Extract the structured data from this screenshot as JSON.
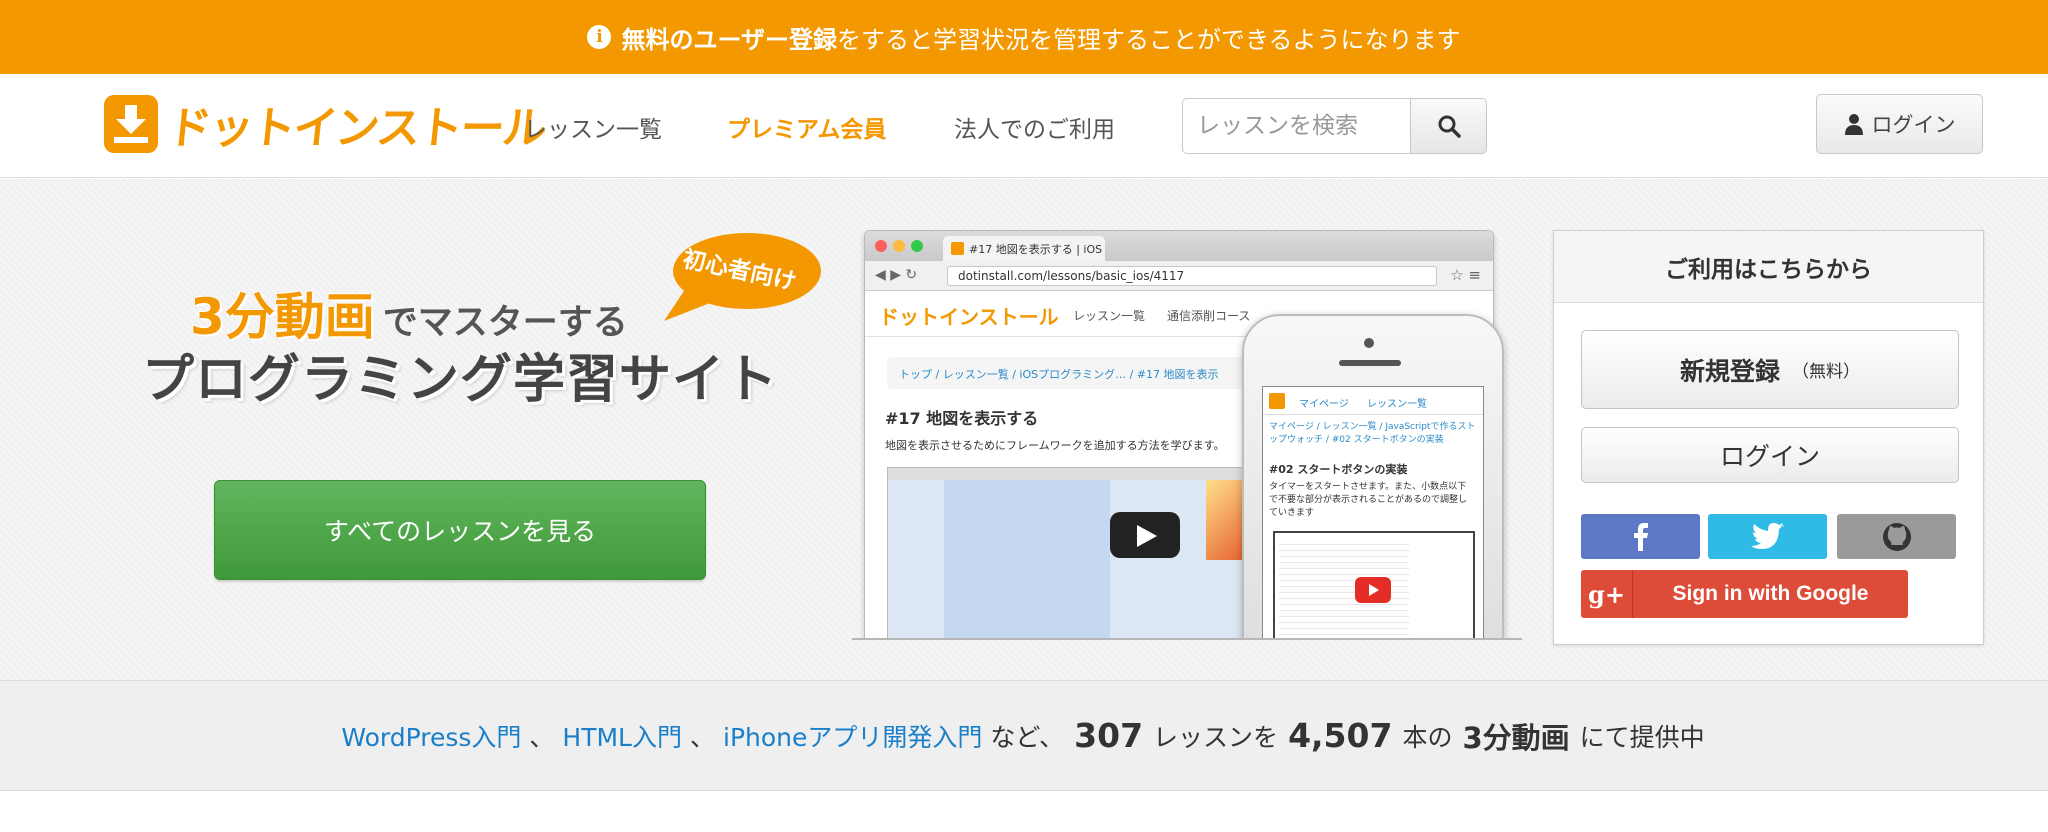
{
  "notice": {
    "icon": "info-icon",
    "bold": "無料のユーザー登録",
    "rest": "をすると学習状況を管理することができるようになります",
    "bg": "#f39800"
  },
  "header": {
    "logo_text": "ドットインストール",
    "nav": [
      "レッスン一覧",
      "プレミアム会員",
      "法人でのご利用"
    ],
    "search_placeholder": "レッスンを検索",
    "login_label": "ログイン",
    "accent": "#f39800"
  },
  "hero": {
    "tag_big": "3分動画",
    "tag_small": "でマスターする",
    "tag_main": "プログラミング学習サイト",
    "bubble": "初心者向け",
    "cta": "すべてのレッスンを見る",
    "browser": {
      "tab_title": "#17 地図を表示する | iOS",
      "url": "dotinstall.com/lessons/basic_ios/4117",
      "logo": "ドットインストール",
      "nav1": "レッスン一覧",
      "nav2": "通信添削コース",
      "crumb": "トップ / レッスン一覧 / iOSプログラミング… / #17 地図を表示",
      "title": "#17 地図を表示する",
      "desc": "地図を表示させるためにフレームワークを追加する方法を学びます。"
    },
    "phone": {
      "nav1": "マイページ",
      "nav2": "レッスン一覧",
      "crumb": "マイページ / レッスン一覧 / JavaScriptで作るストップウォッチ / #02 スタートボタンの実装",
      "title": "#02 スタートボタンの実装",
      "desc": "タイマーをスタートさせます。また、小数点以下で不要な部分が表示されることがあるので調整していきます"
    }
  },
  "panel": {
    "title": "ご利用はこちらから",
    "signup": "新規登録",
    "signup_note": "（無料）",
    "login": "ログイン",
    "sns": [
      "facebook-icon",
      "twitter-icon",
      "github-icon"
    ],
    "google": "Sign in with Google",
    "google_badge": "g+"
  },
  "stats": {
    "links": [
      "WordPress入門",
      "HTML入門",
      "iPhoneアプリ開発入門"
    ],
    "sep": "、",
    "t_nado": "など、",
    "lessons": "307",
    "t_lesson": "レッスンを",
    "videos": "4,507",
    "t_hon": "本の",
    "t_3min": "3分動画",
    "t_end": "にて提供中"
  }
}
